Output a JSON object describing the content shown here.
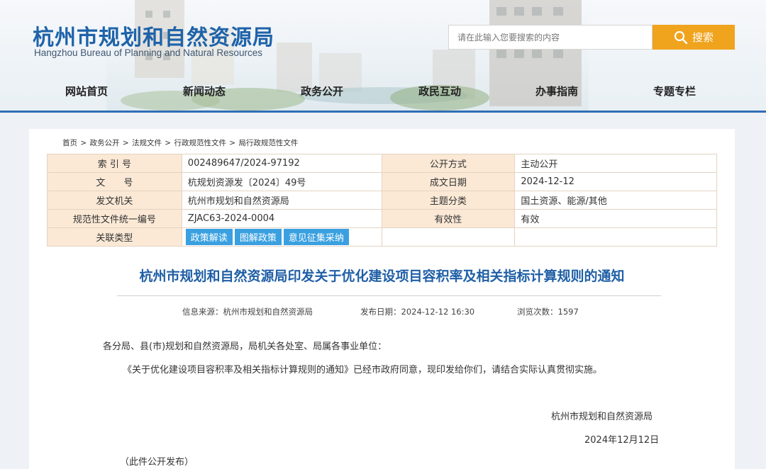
{
  "brand": {
    "title": "杭州市规划和自然资源局",
    "subtitle": "Hangzhou Bureau of Planning and Natural Resources"
  },
  "search": {
    "placeholder": "请在此输入您要搜索的内容",
    "button_label": "搜索"
  },
  "nav": [
    "网站首页",
    "新闻动态",
    "政务公开",
    "政民互动",
    "办事指南",
    "专题专栏"
  ],
  "breadcrumb": [
    "首页",
    "政务公开",
    "法规文件",
    "行政规范性文件",
    "局行政规范性文件"
  ],
  "meta": {
    "rows": [
      {
        "label1": "索 引 号",
        "value1": "002489647/2024-97192",
        "label2": "公开方式",
        "value2": "主动公开"
      },
      {
        "label1": "文　　号",
        "value1": "杭规划资源发〔2024〕49号",
        "label2": "成文日期",
        "value2": "2024-12-12"
      },
      {
        "label1": "发文机关",
        "value1": "杭州市规划和自然资源局",
        "label2": "主题分类",
        "value2": "国土资源、能源/其他"
      },
      {
        "label1": "规范性文件统一编号",
        "value1": "ZJAC63-2024-0004",
        "label2": "有效性",
        "value2": "有效"
      }
    ],
    "related_label": "关联类型",
    "related_tags": [
      "政策解读",
      "图解政策",
      "意见征集采纳"
    ]
  },
  "article": {
    "title": "杭州市规划和自然资源局印发关于优化建设项目容积率及相关指标计算规则的通知",
    "source": "信息来源：杭州市规划和自然资源局",
    "publish_date": "发布日期：2024-12-12 16:30",
    "views": "浏览次数：1597",
    "salutation": "各分局、县(市)规划和自然资源局，局机关各处室、局属各事业单位：",
    "body": "《关于优化建设项目容积率及相关指标计算规则的通知》已经市政府同意，现印发给你们，请结合实际认真贯彻实施。",
    "signature": "杭州市规划和自然资源局",
    "sign_date": "2024年12月12日",
    "footer_note": "（此件公开发布）"
  },
  "colors": {
    "brand_blue": "#1e63a9",
    "search_orange": "#f0a31d",
    "label_bg": "#fbe9d6",
    "tag_blue": "#3aa0e0"
  }
}
